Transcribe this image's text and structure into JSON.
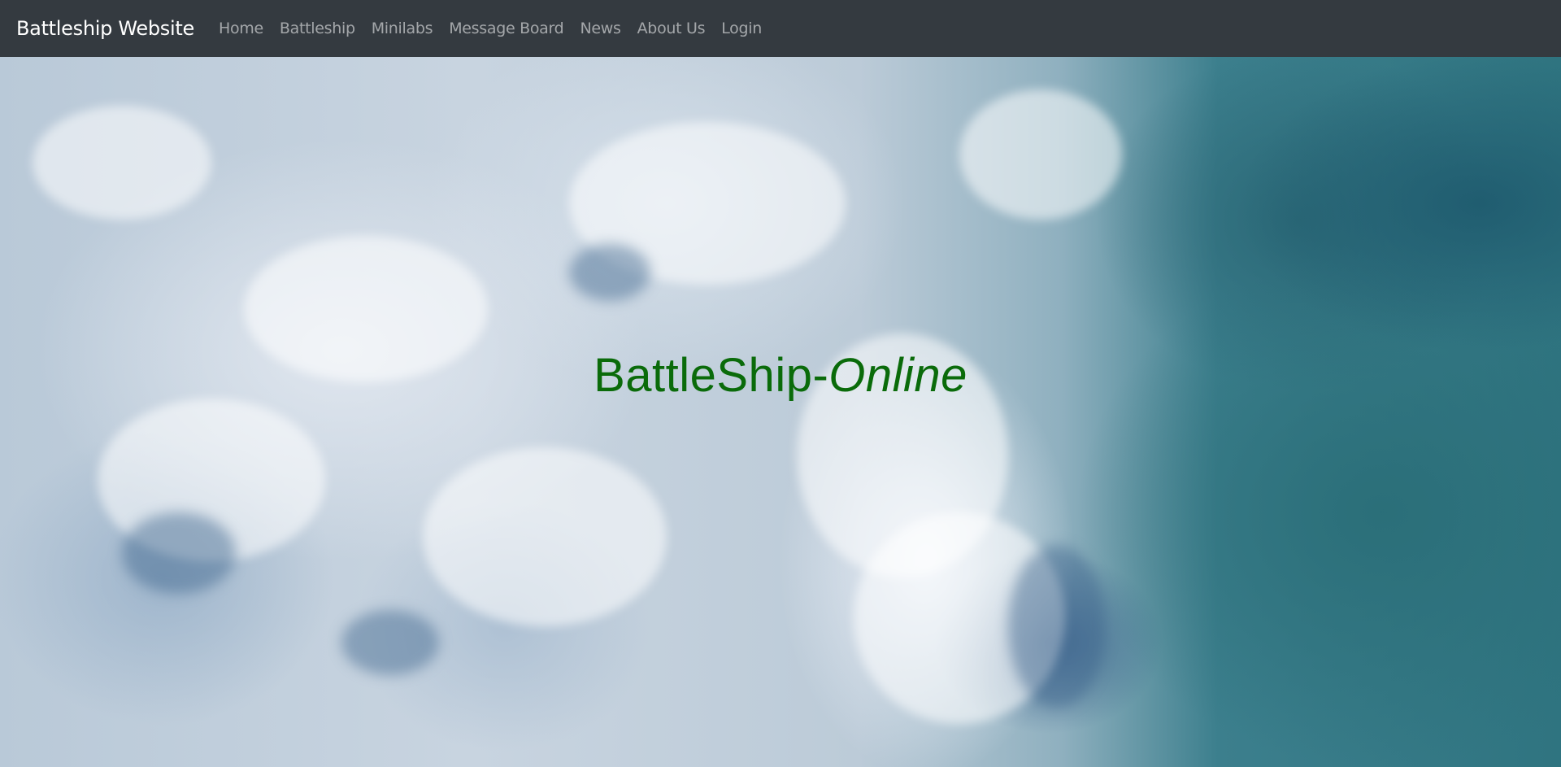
{
  "navbar": {
    "brand": "Battleship Website",
    "links": [
      {
        "label": "Home"
      },
      {
        "label": "Battleship"
      },
      {
        "label": "Minilabs"
      },
      {
        "label": "Message Board"
      },
      {
        "label": "News"
      },
      {
        "label": "About Us"
      },
      {
        "label": "Login"
      }
    ],
    "background_color": "#343a40"
  },
  "hero": {
    "title_main": "BattleShip-",
    "title_italic": "Online",
    "title_color": "#0a6b0a",
    "background": "ocean-waves-aerial-image"
  }
}
